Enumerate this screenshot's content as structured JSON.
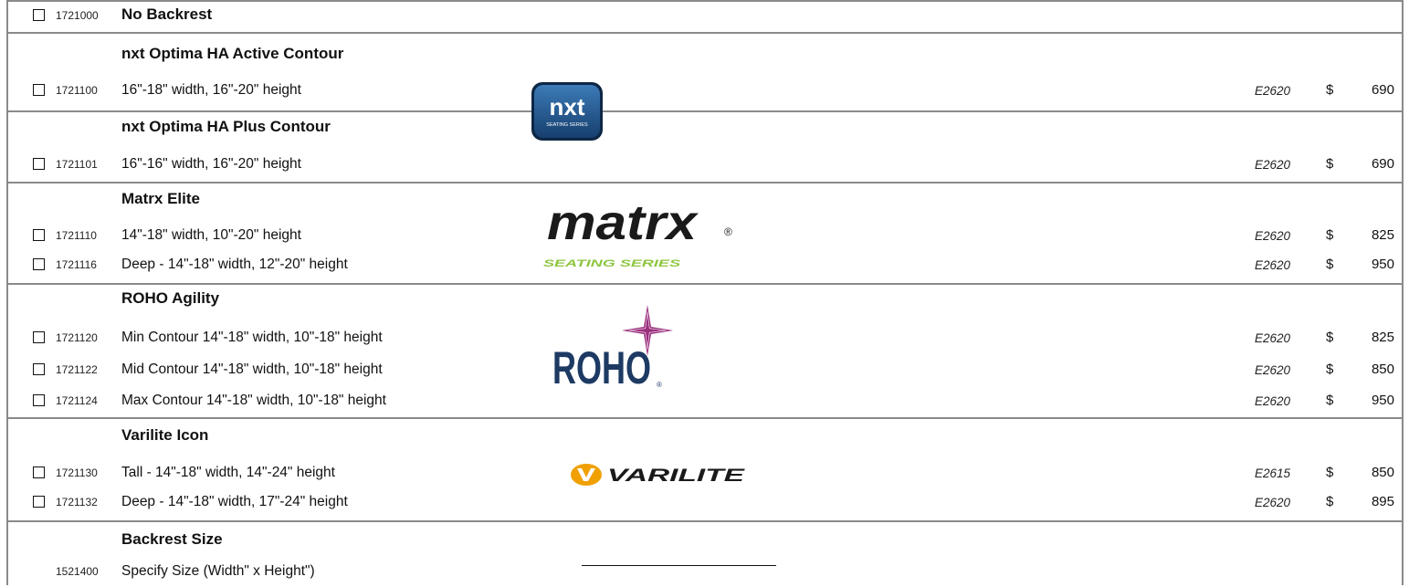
{
  "sections": {
    "no_backrest": {
      "code": "1721000",
      "title": "No Backrest"
    },
    "nxt_active": {
      "title": "nxt Optima HA Active Contour",
      "items": [
        {
          "code": "1721100",
          "desc": "16\"-18\" width, 16\"-20\" height",
          "hcpcs": "E2620",
          "currency": "$",
          "price": "690"
        }
      ]
    },
    "nxt_plus": {
      "title": "nxt Optima HA Plus Contour",
      "items": [
        {
          "code": "1721101",
          "desc": "16\"-16\" width, 16\"-20\" height",
          "hcpcs": "E2620",
          "currency": "$",
          "price": "690"
        }
      ]
    },
    "matrx": {
      "title": "Matrx Elite",
      "items": [
        {
          "code": "1721110",
          "desc": "14\"-18\" width, 10\"-20\" height",
          "hcpcs": "E2620",
          "currency": "$",
          "price": "825"
        },
        {
          "code": "1721116",
          "desc": "Deep - 14\"-18\" width, 12\"-20\" height",
          "hcpcs": "E2620",
          "currency": "$",
          "price": "950"
        }
      ]
    },
    "roho": {
      "title": "ROHO Agility",
      "items": [
        {
          "code": "1721120",
          "desc": "Min Contour 14\"-18\" width, 10\"-18\" height",
          "hcpcs": "E2620",
          "currency": "$",
          "price": "825"
        },
        {
          "code": "1721122",
          "desc": "Mid Contour 14\"-18\" width, 10\"-18\" height",
          "hcpcs": "E2620",
          "currency": "$",
          "price": "850"
        },
        {
          "code": "1721124",
          "desc": "Max Contour 14\"-18\" width, 10\"-18\" height",
          "hcpcs": "E2620",
          "currency": "$",
          "price": "950"
        }
      ]
    },
    "varilite": {
      "title": "Varilite Icon",
      "items": [
        {
          "code": "1721130",
          "desc": "Tall - 14\"-18\" width, 14\"-24\" height",
          "hcpcs": "E2615",
          "currency": "$",
          "price": "850"
        },
        {
          "code": "1721132",
          "desc": "Deep - 14\"-18\" width, 17\"-24\" height",
          "hcpcs": "E2620",
          "currency": "$",
          "price": "895"
        }
      ]
    },
    "backrest_size": {
      "title": "Backrest Size",
      "code": "1521400",
      "desc": "Specify Size (Width\" x Height\")"
    }
  },
  "logos": {
    "nxt": {
      "text": "nxt",
      "sub": "SEATING SERIES",
      "color": "#1f4f86"
    },
    "matrx": {
      "text": "matrx",
      "sub": "SEATING SERIES",
      "reg": "®",
      "color": "#1a1a1a",
      "accent": "#8dc63f"
    },
    "roho": {
      "text": "ROHO",
      "reg": "®",
      "color": "#1d3a63",
      "accent": "#9b2f7e"
    },
    "varilite": {
      "text": "VARILITE",
      "color": "#1a1a1a",
      "accent": "#f0a000"
    }
  },
  "colors": {
    "border": "#8a8a8a",
    "text": "#111111"
  }
}
